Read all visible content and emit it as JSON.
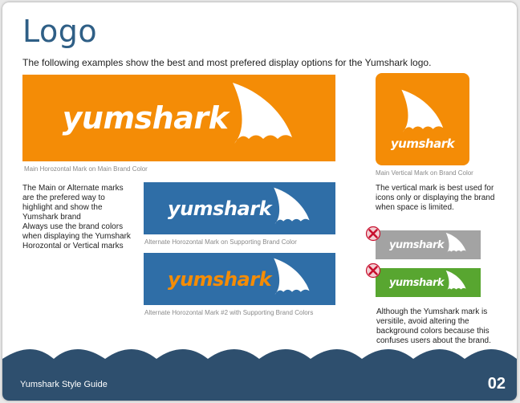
{
  "page": {
    "title": "Logo",
    "intro": "The following examples show the best and most prefered display options for the Yumshark logo."
  },
  "logos": {
    "main": {
      "wordmark": "yumshark",
      "caption": "Main Horozontal Mark on Main Brand Color",
      "bg": "#f48c06",
      "text_color": "#ffffff"
    },
    "vertical": {
      "wordmark": "yumshark",
      "caption": "Main Vertical Mark on Brand Color",
      "bg": "#f48c06",
      "text_color": "#ffffff"
    },
    "alternate": {
      "wordmark": "yumshark",
      "caption": "Alternate Horozontal Mark on Supporting Brand Color",
      "bg": "#2f6ea7",
      "text_color": "#ffffff"
    },
    "alternate2": {
      "wordmark": "yumshark",
      "caption": "Alternate Horozontal Mark #2 with Supporting Brand Colors",
      "bg": "#2f6ea7",
      "text_color": "#f48c06"
    },
    "bad_gray": {
      "wordmark": "yumshark",
      "bg": "#a3a3a3",
      "text_color": "#ffffff"
    },
    "bad_green": {
      "wordmark": "yumshark",
      "bg": "#58a630",
      "text_color": "#ffffff"
    }
  },
  "text": {
    "left_p1": "The Main or Alternate marks are the prefered way to highlight and show the Yumshark brand",
    "left_p2": "Always use the brand colors when displaying the Yumshark Horozontal or Vertical marks",
    "right_p1": "The vertical mark is best used for icons only or displaying the brand when space is limited.",
    "right_p2": "Although the Yumshark mark is versitile, avoid altering the background colors because this confuses users about the brand."
  },
  "icons": {
    "fin": "shark-fin-icon",
    "wrong": "x-circle-icon"
  },
  "colors": {
    "footer": "#2e4f6e",
    "wrong_x": "#c8102e"
  },
  "footer": {
    "title": "Yumshark Style Guide",
    "page_number": "02"
  }
}
